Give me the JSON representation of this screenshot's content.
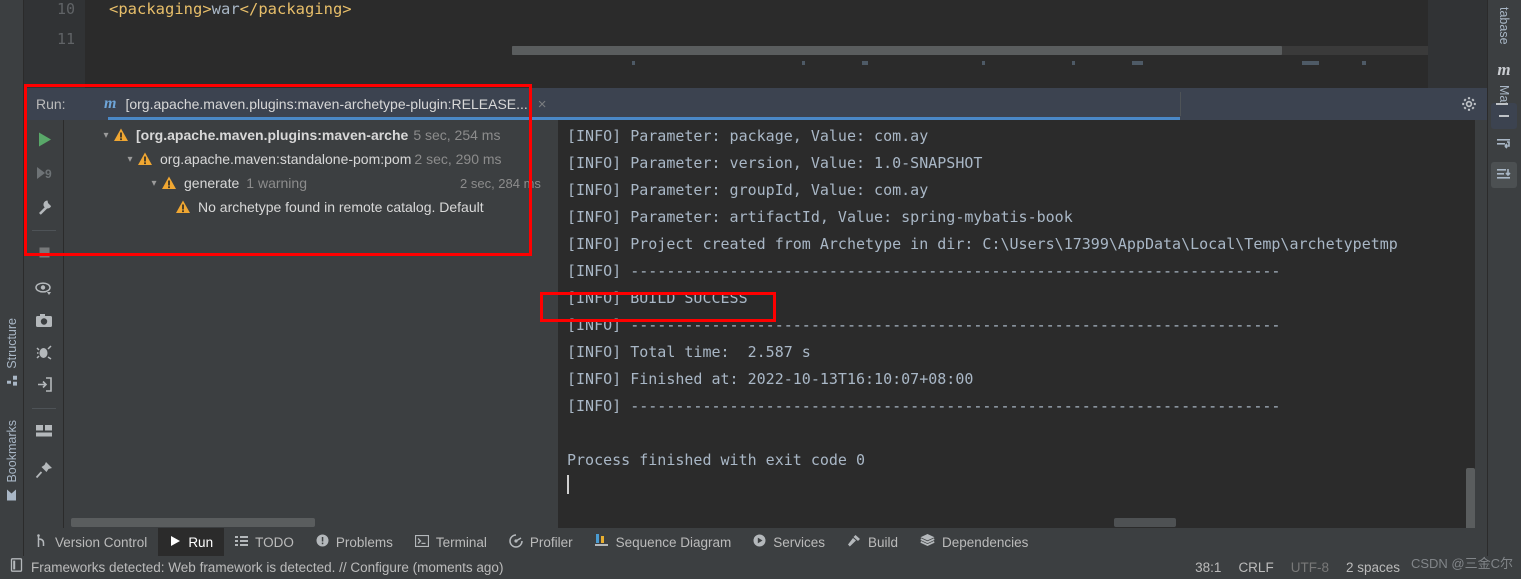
{
  "editor": {
    "lines": [
      {
        "num": "10",
        "code_tag_open": "<packaging>",
        "code_text": "war",
        "code_tag_close": "</packaging>"
      },
      {
        "num": "11",
        "code_tag_open": "",
        "code_text": "",
        "code_tag_close": ""
      }
    ],
    "line_numbers": [
      "10",
      "11"
    ]
  },
  "left_sidebar": {
    "items": [
      {
        "label": "Structure",
        "icon": "structure-icon"
      },
      {
        "label": "Bookmarks",
        "icon": "bookmark-icon"
      }
    ]
  },
  "right_sidebar": {
    "items": [
      {
        "label": "tabase",
        "icon": "database-icon"
      },
      {
        "label": "Maven",
        "icon": "maven-m-icon"
      }
    ],
    "buttons": [
      {
        "name": "collapse-all-icon"
      },
      {
        "name": "expand-all-icon"
      },
      {
        "name": "download-sources-icon"
      }
    ]
  },
  "run_window": {
    "label": "Run:",
    "tab": {
      "icon": "maven-m-icon",
      "title": "[org.apache.maven.plugins:maven-archetype-plugin:RELEASE...",
      "close": "×"
    },
    "header_buttons": [
      {
        "name": "settings-gear-icon",
        "glyph": "gear"
      },
      {
        "name": "minimize-icon",
        "glyph": "minus"
      }
    ],
    "toolbar": [
      {
        "name": "rerun-button",
        "glyph": "play"
      },
      {
        "name": "rerun-failed-tests-button",
        "glyph": "rerun-failed"
      },
      {
        "name": "run-configuration-settings-button",
        "glyph": "wrench"
      },
      {
        "name": "stop-button",
        "glyph": "stop"
      },
      {
        "name": "filter-tests-button",
        "glyph": "eye"
      },
      {
        "name": "export-snapshot-button",
        "glyph": "camera"
      },
      {
        "name": "debug-button",
        "glyph": "bug"
      },
      {
        "name": "import-tests-button",
        "glyph": "import"
      },
      {
        "name": "layout-settings-button",
        "glyph": "layout"
      },
      {
        "name": "pin-tab-button",
        "glyph": "pin"
      }
    ],
    "tree": [
      {
        "depth": 0,
        "expanded": true,
        "icon": "warning-icon",
        "label": "[org.apache.maven.plugins:maven-arche",
        "bold": true,
        "sublabel": "",
        "time": "5 sec, 254 ms"
      },
      {
        "depth": 1,
        "expanded": true,
        "icon": "warning-icon",
        "label": "org.apache.maven:standalone-pom:pom",
        "bold": false,
        "sublabel": "",
        "time": "2 sec, 290 ms"
      },
      {
        "depth": 2,
        "expanded": true,
        "icon": "warning-icon",
        "label": "generate",
        "bold": false,
        "sublabel": "1 warning",
        "time": "2 sec, 284 ms"
      },
      {
        "depth": 3,
        "expanded": false,
        "icon": "warning-icon",
        "label": "No archetype found in remote catalog. Default",
        "bold": false,
        "sublabel": "",
        "time": ""
      }
    ],
    "console_lines": [
      "[INFO] Parameter: package, Value: com.ay",
      "[INFO] Parameter: version, Value: 1.0-SNAPSHOT",
      "[INFO] Parameter: groupId, Value: com.ay",
      "[INFO] Parameter: artifactId, Value: spring-mybatis-book",
      "[INFO] Project created from Archetype in dir: C:\\Users\\17399\\AppData\\Local\\Temp\\archetypetmp",
      "[INFO] ------------------------------------------------------------------------",
      "[INFO] BUILD SUCCESS",
      "[INFO] ------------------------------------------------------------------------",
      "[INFO] Total time:  2.587 s",
      "[INFO] Finished at: 2022-10-13T16:10:07+08:00",
      "[INFO] ------------------------------------------------------------------------",
      "",
      "Process finished with exit code 0"
    ]
  },
  "bottom_tabs": [
    {
      "label": "Version Control",
      "icon": "branch-icon",
      "active": false
    },
    {
      "label": "Run",
      "icon": "play-icon",
      "active": true
    },
    {
      "label": "TODO",
      "icon": "list-icon",
      "active": false
    },
    {
      "label": "Problems",
      "icon": "exclamation-circle-icon",
      "active": false
    },
    {
      "label": "Terminal",
      "icon": "terminal-icon",
      "active": false
    },
    {
      "label": "Profiler",
      "icon": "profiler-icon",
      "active": false
    },
    {
      "label": "Sequence Diagram",
      "icon": "sequence-diagram-icon",
      "active": false
    },
    {
      "label": "Services",
      "icon": "services-icon",
      "active": false
    },
    {
      "label": "Build",
      "icon": "hammer-icon",
      "active": false
    },
    {
      "label": "Dependencies",
      "icon": "layers-icon",
      "active": false
    }
  ],
  "status_bar": {
    "message": "Frameworks detected: Web framework is detected. // Configure (moments ago)",
    "message_icon": "inspection-icon",
    "position": "38:1",
    "line_separator": "CRLF",
    "encoding": "UTF-8",
    "indent": "2 spaces",
    "watermark": "CSDN @三金C尔"
  },
  "colors": {
    "accent_blue": "#4A88C7",
    "warning_yellow": "#F0A732",
    "annotation_red": "#FF0000",
    "console_bg": "#2B2B2B",
    "panel_bg": "#3C3F41",
    "header_bg": "#3C4350"
  }
}
